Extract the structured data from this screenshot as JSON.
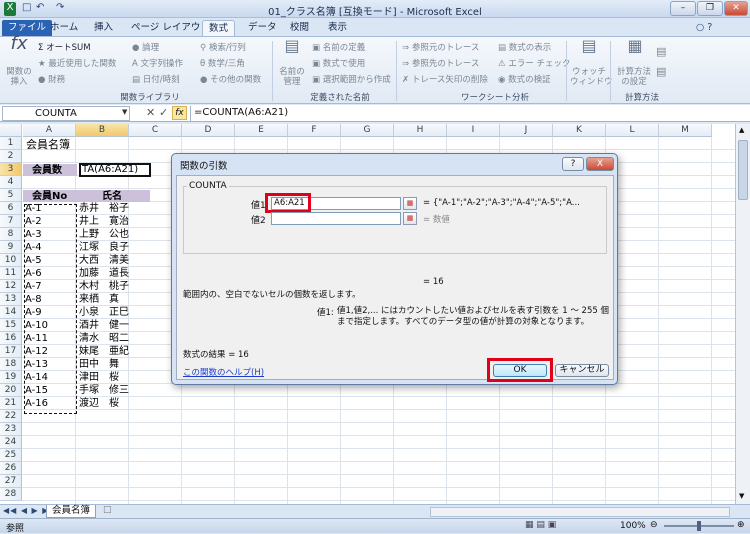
{
  "window": {
    "title": "01_クラス名簿 [互換モード] - Microsoft Excel"
  },
  "tabs": [
    "ファイル",
    "ホーム",
    "挿入",
    "ページ レイアウト",
    "数式",
    "データ",
    "校閲",
    "表示"
  ],
  "ribbon": {
    "insert_function": "関数の\n挿入",
    "autosum": "オートSUM",
    "recent": "最近使用した関数",
    "financial": "財務",
    "logical": "論理",
    "text": "文字列操作",
    "datetime": "日付/時刻",
    "lookup": "検索/行列",
    "math": "数学/三角",
    "other": "その他の関数",
    "group_library": "関数ライブラリ",
    "name_manager": "名前の\n管理",
    "define_name": "名前の定義",
    "use_in_formula": "数式で使用",
    "create_from_sel": "選択範囲から作成",
    "group_names": "定義された名前",
    "trace_prec": "参照元のトレース",
    "trace_dep": "参照先のトレース",
    "remove_arrows": "トレース矢印の削除",
    "show_formulas": "数式の表示",
    "error_check": "エラー チェック",
    "evaluate": "数式の検証",
    "group_audit": "ワークシート分析",
    "watch": "ウォッチ\nウィンドウ",
    "calc_options": "計算方法\nの設定",
    "group_calc": "計算方法"
  },
  "formula_bar": {
    "name_box": "COUNTA",
    "formula": "=COUNTA(A6:A21)"
  },
  "grid": {
    "columns": [
      "A",
      "B",
      "C",
      "D",
      "E",
      "F",
      "G",
      "H",
      "I",
      "J",
      "K",
      "L",
      "M"
    ],
    "rows": [
      "1",
      "2",
      "3",
      "4",
      "5",
      "6",
      "7",
      "8",
      "9",
      "10",
      "11",
      "12",
      "13",
      "14",
      "15",
      "16",
      "17",
      "18",
      "19",
      "20",
      "21",
      "22",
      "23",
      "24",
      "25",
      "26",
      "27",
      "28"
    ],
    "a1": "会員名簿",
    "a3": "会員数",
    "b3": "TA(A6:A21)",
    "a5": "会員No",
    "b5": "氏名",
    "members": [
      [
        "A-1",
        "赤井　裕子"
      ],
      [
        "A-2",
        "井上　寛治"
      ],
      [
        "A-3",
        "上野　公也"
      ],
      [
        "A-4",
        "江塚　良子"
      ],
      [
        "A-5",
        "大西　清美"
      ],
      [
        "A-6",
        "加藤　道長"
      ],
      [
        "A-7",
        "木村　桃子"
      ],
      [
        "A-8",
        "来栖　真"
      ],
      [
        "A-9",
        "小泉　正巳"
      ],
      [
        "A-10",
        "酒井　健一"
      ],
      [
        "A-11",
        "清水　昭二"
      ],
      [
        "A-12",
        "妹尾　亜紀"
      ],
      [
        "A-13",
        "田中　舞"
      ],
      [
        "A-14",
        "津田　桜"
      ],
      [
        "A-15",
        "手塚　修三"
      ],
      [
        "A-16",
        "渡辺　桜"
      ]
    ]
  },
  "sheet_tab": "会員名簿",
  "status": {
    "mode": "参照",
    "zoom": "100%"
  },
  "dialog": {
    "title": "関数の引数",
    "help_glyph": "?",
    "close_glyph": "X",
    "function": "COUNTA",
    "arg1_label": "値1",
    "arg1_value": "A6:A21",
    "arg1_result": "= {\"A-1\";\"A-2\";\"A-3\";\"A-4\";\"A-5\";\"A...",
    "arg2_label": "値2",
    "arg2_result": "= 数値",
    "total_result": "=  16",
    "description": "範囲内の、空白でないセルの個数を返します。",
    "arg_desc_label": "値1:",
    "arg_desc": "値1,値2,... にはカウントしたい値およびセルを表す引数を 1 ～ 255 個まで指定します。すべてのデータ型の値が計算の対象となります。",
    "formula_result": "数式の結果 =  16",
    "help_link": "この関数のヘルプ(H)",
    "ok": "OK",
    "cancel": "キャンセル"
  },
  "colors": {
    "header_fill": "#ccc0da",
    "ok_highlight": "#e0001a",
    "file_tab": "#2a62b4"
  }
}
